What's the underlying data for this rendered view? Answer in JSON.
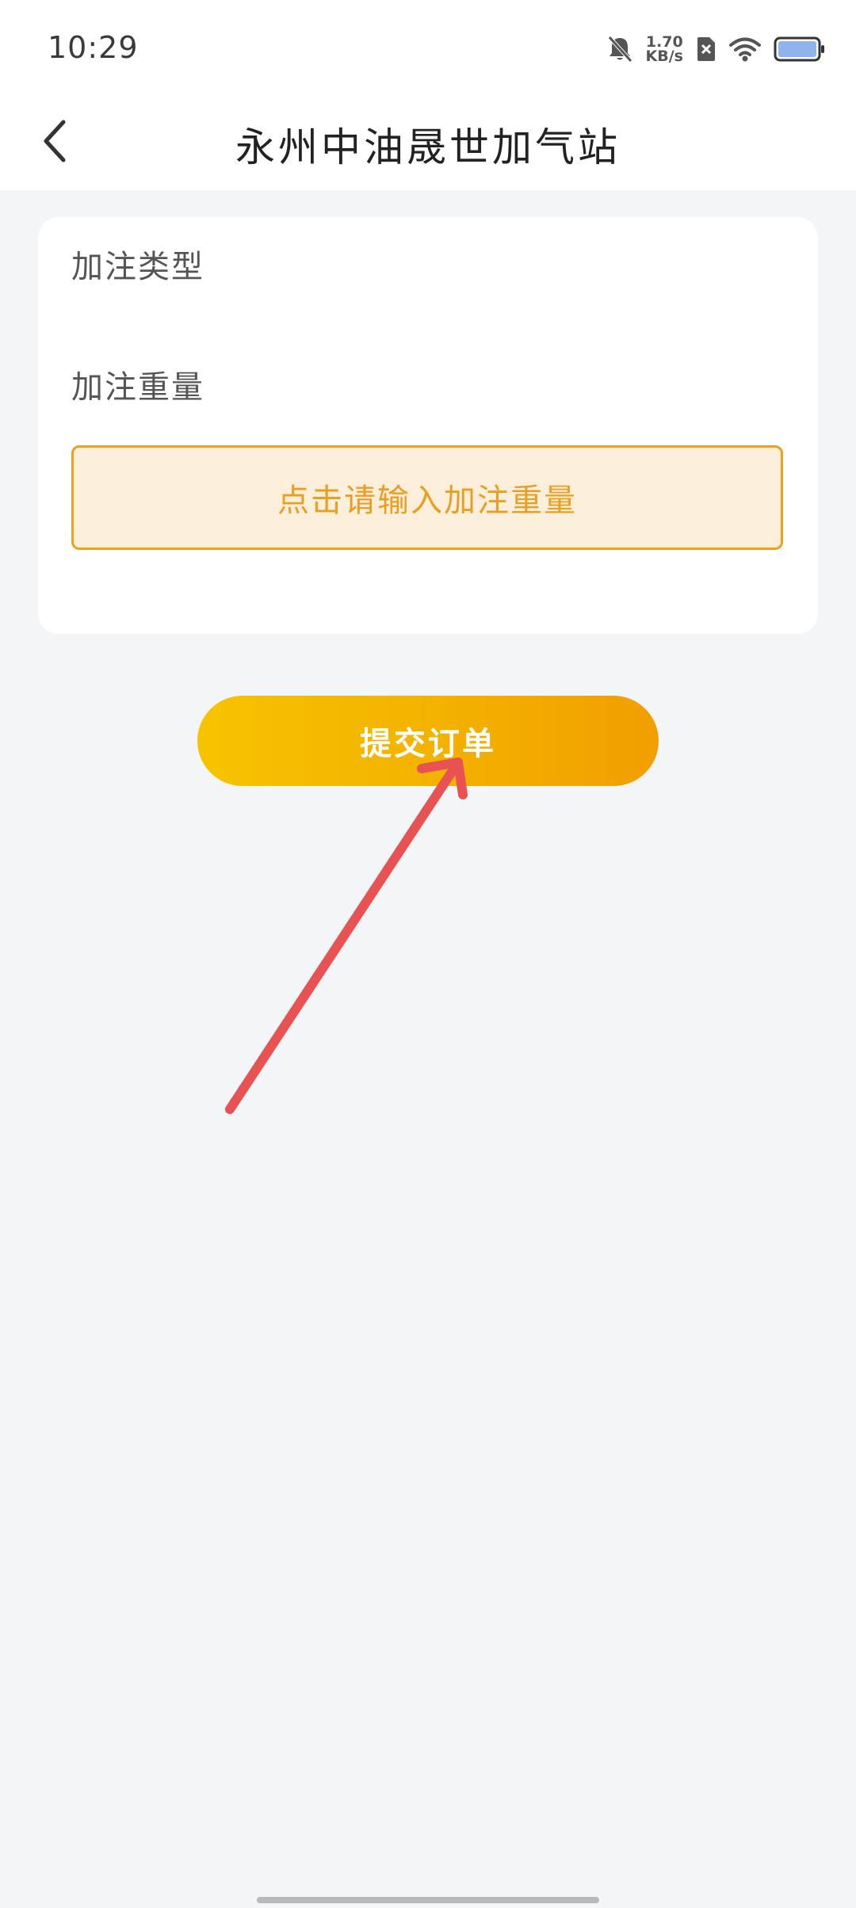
{
  "status_bar": {
    "time": "10:29",
    "net_speed_value": "1.70",
    "net_speed_unit": "KB/s",
    "icons": [
      "bell-muted-icon",
      "sim-disabled-icon",
      "wifi-icon",
      "battery-icon"
    ]
  },
  "nav": {
    "back_icon": "chevron-left-icon",
    "title": "永州中油晟世加气站"
  },
  "form": {
    "type_label": "加注类型",
    "weight_label": "加注重量",
    "weight_placeholder": "点击请输入加注重量"
  },
  "actions": {
    "submit_label": "提交订单"
  },
  "colors": {
    "accent": "#F4B400",
    "input_border": "#EBA31F",
    "input_bg": "#FBEEDB",
    "annotation": "#E85252"
  }
}
